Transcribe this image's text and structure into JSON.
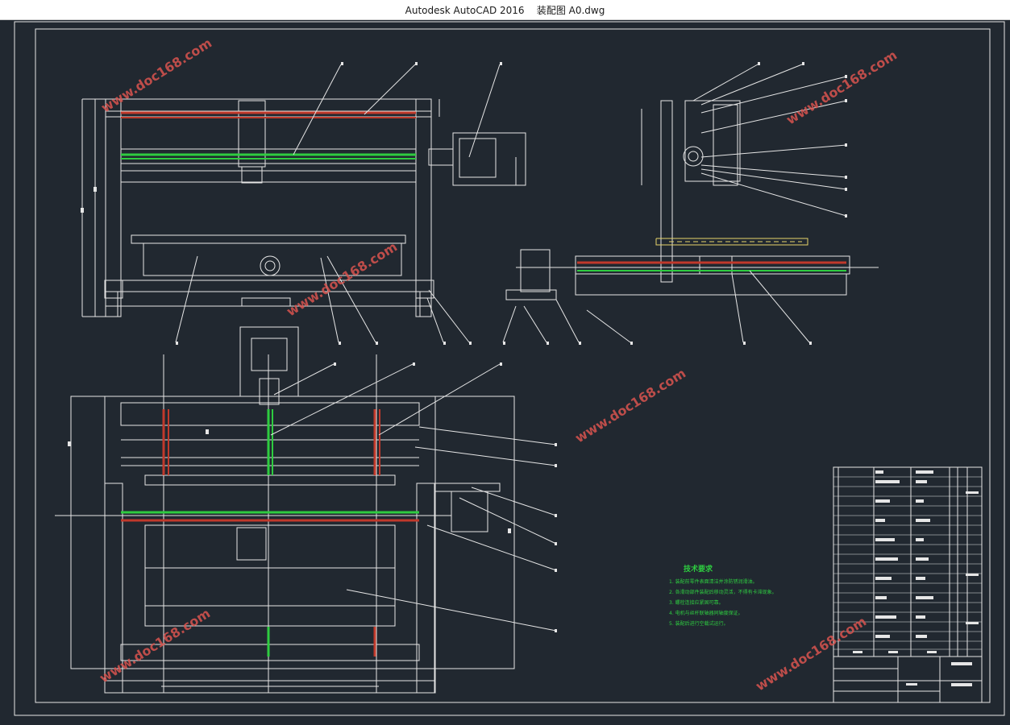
{
  "window": {
    "app_name": "Autodesk AutoCAD 2016",
    "file_name": "装配图 A0.dwg"
  },
  "colors": {
    "background": "#212830",
    "line": "#e6e6e6",
    "rail_red": "#c0392b",
    "rail_green": "#2ecc40",
    "text_green": "#2ecc40",
    "section_yellow": "#e6d36a",
    "watermark": "#d9534f"
  },
  "drawing": {
    "watermark_text": "www.doc168.com",
    "tech_requirements": {
      "heading": "技术要求",
      "items": [
        "1. 装配前零件表面清洁并涂防锈润滑油。",
        "2. 各滑动部件装配后移动灵活，不得有卡滞现象。",
        "3. 螺栓连接应紧固可靠。",
        "4. 电机与丝杆联轴器同轴度保证。",
        "5. 装配后进行空载试运行。"
      ]
    }
  }
}
